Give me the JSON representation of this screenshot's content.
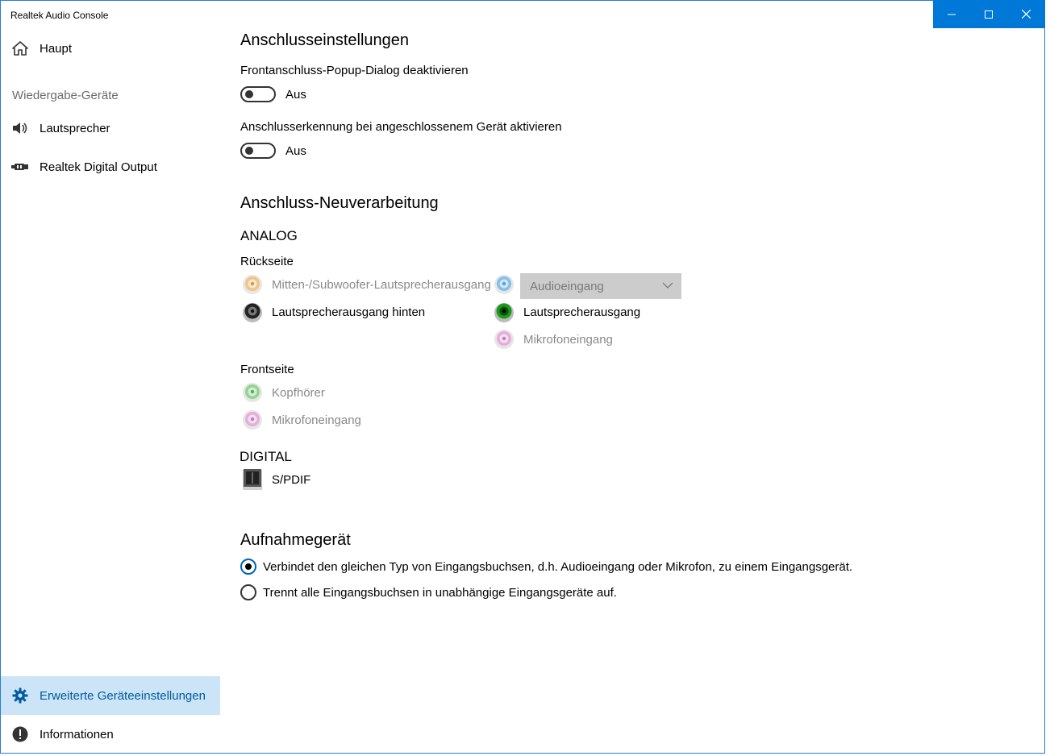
{
  "window": {
    "title": "Realtek Audio Console"
  },
  "sidebar": {
    "home_label": "Haupt",
    "section_playback": "Wiedergabe-Geräte",
    "devices": [
      {
        "label": "Lautsprecher",
        "icon": "speaker-icon"
      },
      {
        "label": "Realtek Digital Output",
        "icon": "digital-output-icon"
      }
    ],
    "advanced_label": "Erweiterte Geräteeinstellungen",
    "info_label": "Informationen"
  },
  "connector_settings": {
    "title": "Anschlusseinstellungen",
    "front_popup": {
      "label": "Frontanschluss-Popup-Dialog deaktivieren",
      "state": "Aus",
      "on": false
    },
    "detection": {
      "label": "Anschlusserkennung bei angeschlossenem Gerät aktivieren",
      "state": "Aus",
      "on": false
    }
  },
  "retasking": {
    "title": "Anschluss-Neuverarbeitung",
    "analog_label": "ANALOG",
    "back_label": "Rückseite",
    "back_left": [
      {
        "label": "Mitten-/Subwoofer-Lautsprecherausgang",
        "color": "#f2b866",
        "enabled": false
      },
      {
        "label": "Lautsprecherausgang hinten",
        "color": "#222222",
        "enabled": true
      }
    ],
    "back_right_select": {
      "value": "Audioeingang",
      "color": "#6bb5e8"
    },
    "back_right": [
      {
        "label": "Lautsprecherausgang",
        "color": "#1a9a1a",
        "enabled": true
      },
      {
        "label": "Mikrofoneingang",
        "color": "#e59ad8",
        "enabled": false
      }
    ],
    "front_label": "Frontseite",
    "front": [
      {
        "label": "Kopfhörer",
        "color": "#7ccf7c",
        "enabled": false
      },
      {
        "label": "Mikrofoneingang",
        "color": "#e59ad8",
        "enabled": false
      }
    ],
    "digital_label": "DIGITAL",
    "spdif_label": "S/PDIF"
  },
  "recording": {
    "title": "Aufnahmegerät",
    "options": [
      {
        "label": "Verbindet den gleichen Typ von Eingangsbuchsen, d.h. Audioeingang oder Mikrofon, zu einem Eingangsgerät.",
        "checked": true
      },
      {
        "label": "Trennt alle Eingangsbuchsen in unabhängige Eingangsgeräte auf.",
        "checked": false
      }
    ]
  },
  "colors": {
    "accent": "#0078d7",
    "active_nav_bg": "#cce4f7",
    "active_nav_text": "#005a9e"
  }
}
